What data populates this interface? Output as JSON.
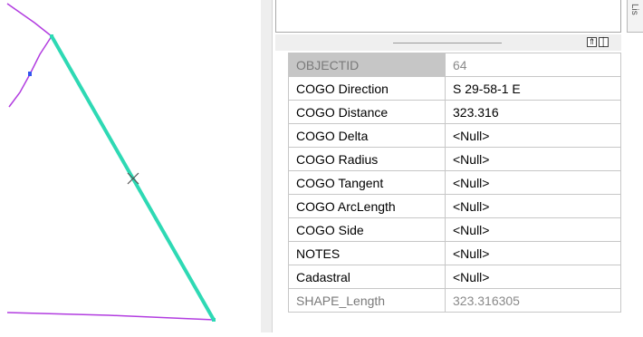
{
  "colors": {
    "line_cyan": "#2ed9b4",
    "line_magenta": "#b23de0",
    "vertex_blue": "#3355ee"
  },
  "side_tab": {
    "label": "Lis"
  },
  "splitter": {
    "button_up_icon": "double-chevron-up-icon",
    "button_pin_icon": "pin-bar-icon"
  },
  "attributes": [
    {
      "name": "OBJECTID",
      "value": "64",
      "readonly": true
    },
    {
      "name": "COGO Direction",
      "value": "S 29-58-1 E",
      "readonly": false
    },
    {
      "name": "COGO Distance",
      "value": "323.316",
      "readonly": false
    },
    {
      "name": "COGO Delta",
      "value": "<Null>",
      "readonly": false
    },
    {
      "name": "COGO Radius",
      "value": "<Null>",
      "readonly": false
    },
    {
      "name": "COGO Tangent",
      "value": "<Null>",
      "readonly": false
    },
    {
      "name": "COGO ArcLength",
      "value": "<Null>",
      "readonly": false
    },
    {
      "name": "COGO Side",
      "value": "<Null>",
      "readonly": false
    },
    {
      "name": "NOTES",
      "value": "<Null>",
      "readonly": false
    },
    {
      "name": "Cadastral",
      "value": "<Null>",
      "readonly": false
    },
    {
      "name": "SHAPE_Length",
      "value": "323.316305",
      "readonly": true
    }
  ]
}
